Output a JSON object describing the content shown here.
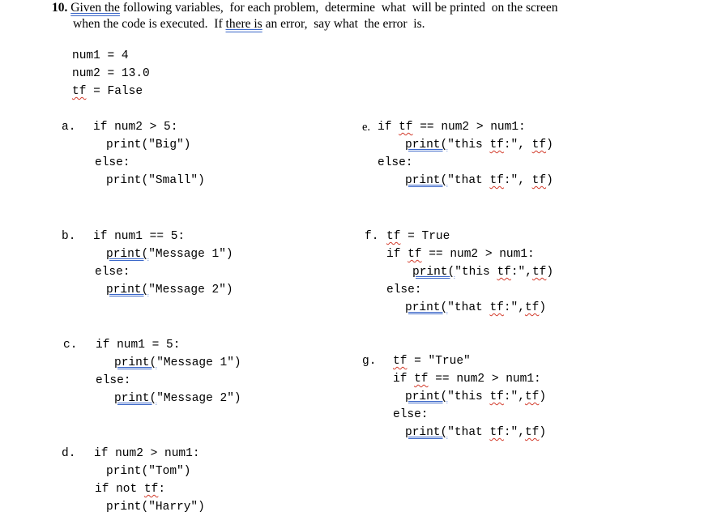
{
  "question": {
    "number": "10.",
    "line1_pre": "",
    "line1_grammar": "Given the",
    "line1_post": " following variables,  for each problem,  determine  what  will be printed  on the screen",
    "line2_pre": "when the code is executed.  If ",
    "line2_grammar": "there is",
    "line2_post": " an error,  say what  the error  is."
  },
  "variables": {
    "num1": "num1 = 4",
    "num2": "num2 = 13.0",
    "tf_name": "tf",
    "tf_rest": " = False"
  },
  "problems": {
    "a": {
      "label": "a.",
      "l1": "if num2 > 5:",
      "l2": "print(\"Big\")",
      "l3": "else:",
      "l4": "print(\"Small\")"
    },
    "b": {
      "label": "b.",
      "l1": "if num1 == 5:",
      "l2_print": "print(",
      "l2_rest": "\"Message 1\")",
      "l3": "else:",
      "l4_print": "print(",
      "l4_rest": "\"Message 2\")"
    },
    "c": {
      "label": "c.",
      "l1": "if num1 = 5:",
      "l2_print": "print(",
      "l2_rest": "\"Message 1\")",
      "l3": "else:",
      "l4_print": "print(",
      "l4_rest": "\"Message 2\")"
    },
    "d": {
      "label": "d.",
      "l1": "if num2 > num1:",
      "l2": "print(\"Tom\")",
      "l3_pre": "if not ",
      "l3_tf": "tf",
      "l3_post": ":",
      "l4": "print(\"Harry\")"
    },
    "e": {
      "label": "e.",
      "l1_pre": "if ",
      "l1_tf": "tf",
      "l1_post": " == num2 > num1:",
      "l2_print": "print(",
      "l2_mid": "\"this ",
      "l2_tf1": "tf",
      "l2_mid2": ":\", ",
      "l2_tf2": "tf",
      "l2_end": ")",
      "l3": "else:",
      "l4_print": "print(",
      "l4_mid": "\"that ",
      "l4_tf1": "tf",
      "l4_mid2": ":\", ",
      "l4_tf2": "tf",
      "l4_end": ")"
    },
    "f": {
      "label": "f.",
      "l0_tf": "tf",
      "l0_post": " = True",
      "l1_pre": "if ",
      "l1_tf": "tf",
      "l1_post": " == num2 > num1:",
      "l2_print": "print(",
      "l2_mid": "\"this ",
      "l2_tf1": "tf",
      "l2_mid2": ":\",",
      "l2_tf2": "tf",
      "l2_end": ")",
      "l3": "else:",
      "l4_print": "print(",
      "l4_mid": "\"that ",
      "l4_tf1": "tf",
      "l4_mid2": ":\",",
      "l4_tf2": "tf",
      "l4_end": ")"
    },
    "g": {
      "label": "g.",
      "l0_tf": "tf",
      "l0_post": " = \"True\"",
      "l1_pre": "if ",
      "l1_tf": "tf",
      "l1_post": " == num2 > num1:",
      "l2_print": "print(",
      "l2_mid": "\"this ",
      "l2_tf1": "tf",
      "l2_mid2": ":\",",
      "l2_tf2": "tf",
      "l2_end": ")",
      "l3": "else:",
      "l4_print": "print(",
      "l4_mid": "\"that ",
      "l4_tf1": "tf",
      "l4_mid2": ":\",",
      "l4_tf2": "tf",
      "l4_end": ")"
    }
  }
}
